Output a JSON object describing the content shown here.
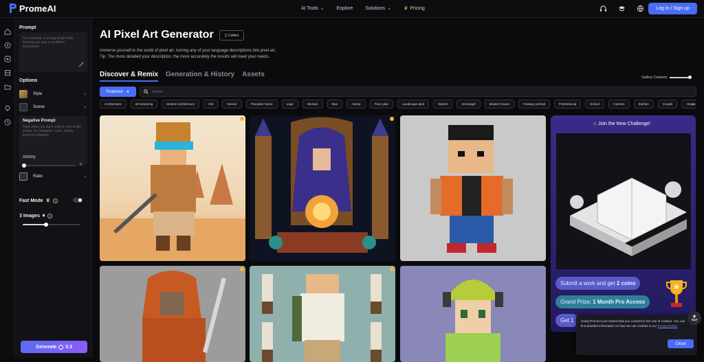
{
  "header": {
    "logo_text": "PromeAI",
    "nav": [
      {
        "label": "AI Tools",
        "has_dropdown": true
      },
      {
        "label": "Explore",
        "has_dropdown": false
      },
      {
        "label": "Solutions",
        "has_dropdown": true
      },
      {
        "label": "Pricing",
        "has_dropdown": false
      }
    ],
    "login_label": "Log in / Sign up",
    "icons": [
      "headset-icon",
      "graduation-cap-icon",
      "globe-icon"
    ]
  },
  "rail_icons": [
    "home-icon",
    "compass-icon",
    "grid-icon",
    "layers-icon",
    "folder-icon",
    "bulb-icon",
    "history-icon",
    "settings-icon"
  ],
  "panel": {
    "prompt_label": "Prompt",
    "prompt_placeholder": "For example: a young knight with flowing hair and a confident expression",
    "options_label": "Options",
    "style_label": "Style",
    "scene_label": "Scene",
    "negative_title": "Negative Prompt",
    "negative_placeholder": "Type what you don't want to see in the image, for example: crack, stains, incorrect shadow",
    "artistry_label": "Artistry",
    "artistry_value": "0",
    "ratio_label": "Ratio",
    "fast_mode_label": "Fast Mode",
    "fast_mode_on": false,
    "images_label": "3 Images",
    "images_level": 0.4,
    "generate_label": "Generate",
    "generate_cost": "0.3"
  },
  "main": {
    "title": "AI Pixel Art Generator",
    "collect_label": "Collect",
    "desc_line1": "Immerse yourself in the world of pixel art, turning any of your language descriptions into pixel art.",
    "desc_line2": "Tip: The more detailed your description, the more accurately the results will meet your needs.",
    "tabs": [
      "Discover & Remix",
      "Generation & History",
      "Assets"
    ],
    "gallery_columns_label": "Gallery Columns:",
    "sort_label": "Featured",
    "search_placeholder": "Search",
    "chips": [
      "Architecture",
      "3d rendering",
      "Modern architecture",
      "Girl",
      "Interior",
      "Floorplan home",
      "Logo",
      "Woman",
      "Man",
      "Anime",
      "Floor plan",
      "Landscape plan",
      "Sketch",
      "Schoolgirl",
      "Modern house",
      "Fantasy portrait",
      "Professional",
      "School",
      "Cartoon",
      "Kitchen",
      "Couple",
      "House floorplan"
    ]
  },
  "promo": {
    "title": "Join the New Challenge!",
    "pill1_prefix": "Submit a work and get ",
    "pill1_bold": "2 coins",
    "pill2_prefix": "Grand Prize: ",
    "pill2_bold": "1 Month Pro Access",
    "pill3_prefix": "Get 1"
  },
  "cookie": {
    "text": "Using PromeAI.pro means that you consent to the use of cookies. You can find detailed information on how we use cookies in our ",
    "link": "Privacy Policy",
    "close_label": "Close"
  },
  "colors": {
    "accent": "#4a6cf7",
    "background": "#0b0b0d",
    "badge": "#f1b640"
  }
}
